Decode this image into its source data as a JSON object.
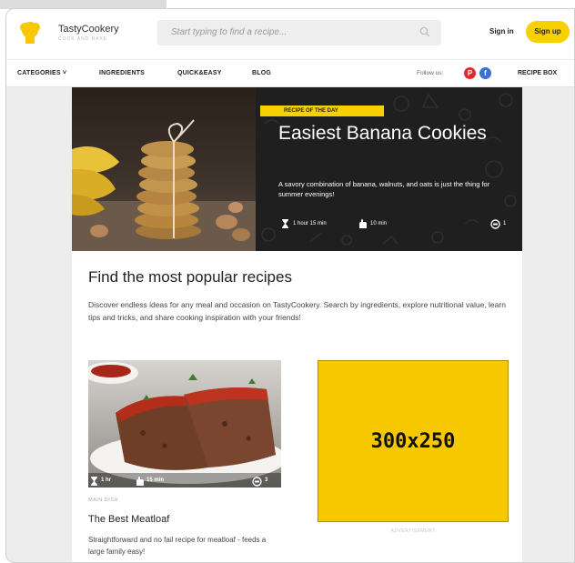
{
  "header": {
    "brand_name": "TastyCookery",
    "brand_tagline": "COOK AND BAKE",
    "search_placeholder": "Start typing to find a recipe...",
    "sign_in": "Sign in",
    "sign_up": "Sign up"
  },
  "nav": {
    "categories": "CATEGORIES ˅",
    "ingredients": "INGREDIENTS",
    "quick_easy": "QUICK&EASY",
    "blog": "BLOG",
    "follow_us": "Follow us:",
    "pinterest_glyph": "P",
    "facebook_glyph": "f",
    "recipe_box": "RECIPE BOX"
  },
  "hero": {
    "badge": "RECIPE OF THE DAY",
    "title": "Easiest Banana Cookies",
    "description": "A savory combination of banana, walnuts, and oats is just the thing for summer evenings!",
    "total_time": "1 hour 15 min",
    "prep_time": "10 min",
    "comments": "1"
  },
  "main": {
    "title": "Find the most popular recipes",
    "description": "Discover endless ideas for any meal and occasion on TastyCookery. Search by ingredients, explore nutritional value, learn tips and tricks, and share cooking inspiration with your friends!"
  },
  "card": {
    "total_time": "1 hr",
    "prep_time": "15 min",
    "comments": "3",
    "category": "MAIN DISH",
    "title": "The Best Meatloaf",
    "description": "Straightforward and no fail recipe for meatloaf - feeds a large family easy!"
  },
  "ad": {
    "label": "300x250",
    "note": "ADVERTISEMENT"
  },
  "colors": {
    "accent_yellow": "#f7d000",
    "ad_yellow": "#f7c800",
    "hero_dark": "#1f1f1f",
    "pinterest": "#e02a30",
    "facebook": "#3b6fd1"
  }
}
